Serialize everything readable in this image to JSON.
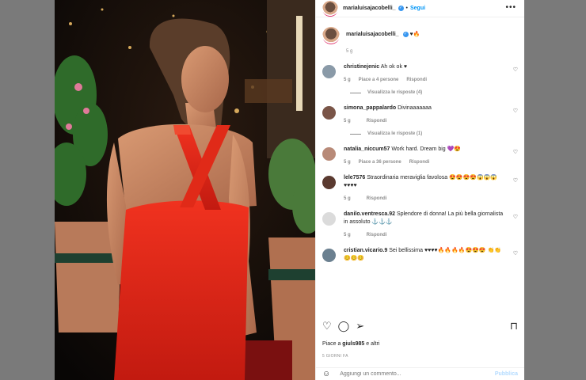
{
  "header": {
    "username": "marialuisajacobelli_",
    "verified_mark": "✓",
    "separator": "•",
    "follow_label": "Segui",
    "more_icon": "more-horizontal-icon",
    "more_glyph": "•••"
  },
  "caption": {
    "username": "marialuisajacobelli_",
    "text": "♥🔥",
    "time": "5 g"
  },
  "comments": [
    {
      "username": "christinejenic",
      "text": "Ah ok ok ♥",
      "time": "5 g",
      "likes": "Piace a 4 persone",
      "reply": "Rispondi",
      "replies": "Visualizza le risposte (4)",
      "avatar_color": "#8a9aa8"
    },
    {
      "username": "simona_pappalardo",
      "text": "Divinaaaaaaa",
      "time": "5 g",
      "likes": "",
      "reply": "Rispondi",
      "replies": "Visualizza le risposte (1)",
      "avatar_color": "#7a5548"
    },
    {
      "username": "natalia_niccum57",
      "text": "Work hard. Dream big 💜😍",
      "time": "5 g",
      "likes": "Piace a 36 persone",
      "reply": "Rispondi",
      "replies": "",
      "avatar_color": "#b88a78"
    },
    {
      "username": "lele7576",
      "text": "Straordinaria meraviglia favolosa 😍😍😍😍😱😱😱♥♥♥♥",
      "time": "5 g",
      "likes": "",
      "reply": "Rispondi",
      "replies": "",
      "avatar_color": "#5a3a30"
    },
    {
      "username": "danilo.ventresca.92",
      "text": "Splendore di donna! La più bella giornalista in assoluto ⚓⚓⚓",
      "time": "5 g",
      "likes": "",
      "reply": "Rispondi",
      "replies": "",
      "avatar_color": "#dbdbdb"
    },
    {
      "username": "cristian.vicario.9",
      "text": "Sei bellissima ♥♥♥♥🔥🔥🔥🔥😍😍😍 👏👏😊😊😊",
      "time": "",
      "likes": "",
      "reply": "",
      "replies": "",
      "avatar_color": "#6b8090"
    }
  ],
  "actions": {
    "like_icon": "heart-icon",
    "comment_icon": "comment-icon",
    "share_icon": "share-icon",
    "save_icon": "bookmark-icon",
    "like_glyph": "♡",
    "comment_glyph": "◯",
    "share_glyph": "➢",
    "save_glyph": "⊓"
  },
  "likes": {
    "prefix": "Piace a ",
    "user": "giuls985",
    "suffix": " e altri"
  },
  "time_ago": "5 GIORNI FA",
  "add_comment": {
    "placeholder": "Aggiungi un commento...",
    "publish_label": "Pubblica",
    "emoji_glyph": "☺"
  },
  "colors": {
    "accent": "#0095f6",
    "dress": "#e8261a",
    "verified": "#3897f0"
  }
}
